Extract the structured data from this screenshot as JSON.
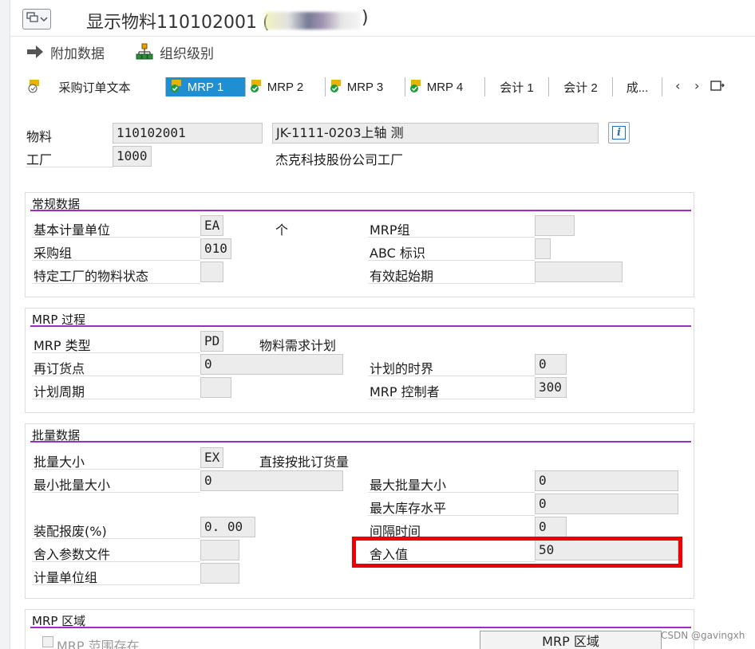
{
  "window": {
    "title": "显示物料110102001 (",
    "title_close": ")"
  },
  "toolbar": {
    "additional_data": "附加数据",
    "org_levels": "组织级别"
  },
  "tabs": [
    {
      "label": "采购订单文本",
      "active": false
    },
    {
      "label": "MRP 1",
      "active": true
    },
    {
      "label": "MRP 2",
      "active": false
    },
    {
      "label": "MRP 3",
      "active": false
    },
    {
      "label": "MRP 4",
      "active": false
    },
    {
      "label": "会计 1",
      "active": false
    },
    {
      "label": "会计 2",
      "active": false
    },
    {
      "label": "成...",
      "active": false
    }
  ],
  "header": {
    "material_label": "物料",
    "material_value": "110102001",
    "material_desc": "JK-1111-0203上轴 测",
    "plant_label": "工厂",
    "plant_value": "1000",
    "plant_desc": "杰克科技股份公司工厂"
  },
  "general": {
    "title": "常规数据",
    "base_uom_label": "基本计量单位",
    "base_uom_value": "EA",
    "base_uom_text": "个",
    "mrp_group_label": "MRP组",
    "mrp_group_value": "",
    "purch_group_label": "采购组",
    "purch_group_value": "010",
    "abc_label": "ABC 标识",
    "abc_value": "",
    "plant_status_label": "特定工厂的物料状态",
    "plant_status_value": "",
    "valid_from_label": "有效起始期",
    "valid_from_value": ""
  },
  "mrp_procedure": {
    "title": "MRP 过程",
    "mrp_type_label": "MRP 类型",
    "mrp_type_value": "PD",
    "mrp_type_text": "物料需求计划",
    "reorder_label": "再订货点",
    "reorder_value": "0",
    "time_fence_label": "计划的时界",
    "time_fence_value": "0",
    "cycle_label": "计划周期",
    "cycle_value": "",
    "controller_label": "MRP 控制者",
    "controller_value": "300"
  },
  "lot_size": {
    "title": "批量数据",
    "lot_size_label": "批量大小",
    "lot_size_value": "EX",
    "lot_size_text": "直接按批订货量",
    "min_lot_label": "最小批量大小",
    "min_lot_value": "0",
    "max_lot_label": "最大批量大小",
    "max_lot_value": "0",
    "max_stock_label": "最大库存水平",
    "max_stock_value": "0",
    "scrap_label": "装配报废(%)",
    "scrap_value": "0. 00",
    "takt_label": "间隔时间",
    "takt_value": "0",
    "rounding_profile_label": "舍入参数文件",
    "rounding_profile_value": "",
    "rounding_value_label": "舍入值",
    "rounding_value_value": "50",
    "uom_group_label": "计量单位组",
    "uom_group_value": ""
  },
  "mrp_area": {
    "title": "MRP 区域",
    "checkbox_label": "MRP  范围存在",
    "button_label": "MRP 区域"
  },
  "watermark": "CSDN @gavingxh",
  "colors": {
    "active_tab": "#1f8fd1",
    "group_line": "#9c2fbf",
    "highlight": "#ee0000"
  }
}
